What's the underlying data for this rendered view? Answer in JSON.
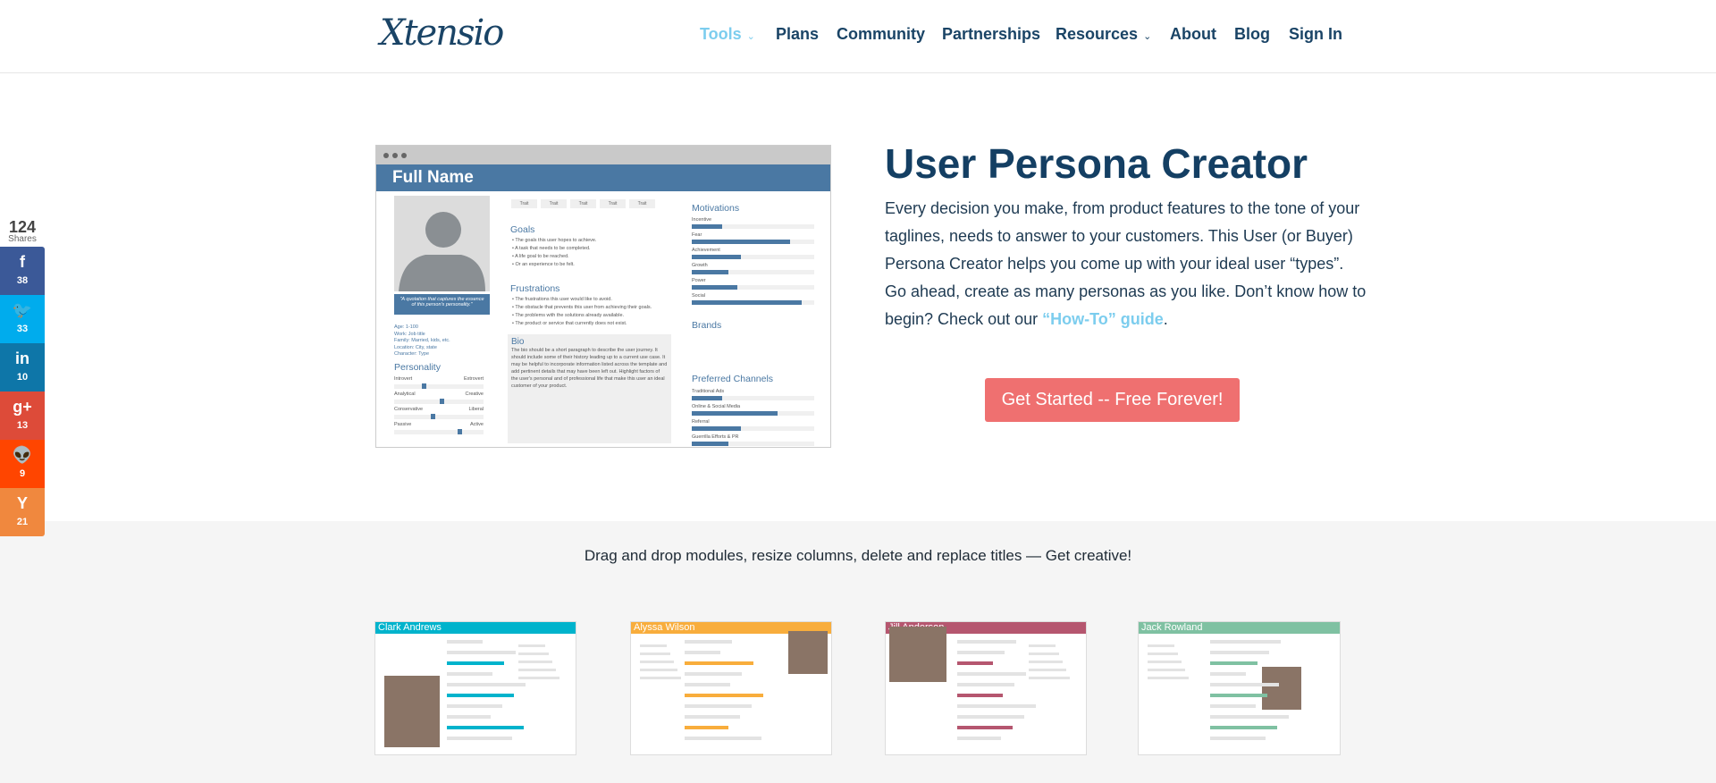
{
  "header": {
    "logo": "Xtensio",
    "nav": [
      {
        "label": "Tools",
        "dropdown": true,
        "active": true
      },
      {
        "label": "Plans"
      },
      {
        "label": "Community"
      },
      {
        "label": "Partnerships"
      },
      {
        "label": "Resources",
        "dropdown": true
      },
      {
        "label": "About"
      },
      {
        "label": "Blog"
      },
      {
        "label": "Sign In"
      }
    ]
  },
  "share": {
    "total": "124",
    "label": "Shares",
    "buttons": [
      {
        "icon": "facebook-icon",
        "glyph": "f",
        "count": "38",
        "color": "#3b5998"
      },
      {
        "icon": "twitter-icon",
        "glyph": "🐦",
        "count": "33",
        "color": "#00aced"
      },
      {
        "icon": "linkedin-icon",
        "glyph": "in",
        "count": "10",
        "color": "#0e76a8"
      },
      {
        "icon": "google-plus-icon",
        "glyph": "g+",
        "count": "13",
        "color": "#dd4b39"
      },
      {
        "icon": "reddit-icon",
        "glyph": "👽",
        "count": "9",
        "color": "#ff4500"
      },
      {
        "icon": "hacker-news-icon",
        "glyph": "Y",
        "count": "21",
        "color": "#f0883e"
      }
    ]
  },
  "hero": {
    "title": "User Persona Creator",
    "text": "Every decision you make, from product features to the tone of your taglines, needs to answer to your customers. This User (or Buyer) Persona Creator helps you come up with your ideal user “types”. Go ahead, create as many personas as you like. Don’t know how to begin? Check out our ",
    "link": "“How-To” guide",
    "text_end": ".",
    "cta": "Get Started -- Free Forever!",
    "cta_color": "#ef7070"
  },
  "mockup": {
    "name": "Full Name",
    "quote": "\"A quotation that captures the essence of this person's personality.\"",
    "info": [
      "Age: 1-100",
      "Work: Job title",
      "Family: Married, kids, etc.",
      "Location: City, state",
      "Character: Type"
    ],
    "personality_title": "Personality",
    "personality": [
      {
        "left": "Introvert",
        "right": "Extrovert",
        "value": 0.33
      },
      {
        "left": "Analytical",
        "right": "Creative",
        "value": 0.53
      },
      {
        "left": "Conservative",
        "right": "Liberal",
        "value": 0.43
      },
      {
        "left": "Passive",
        "right": "Active",
        "value": 0.73
      }
    ],
    "traits": [
      "Trait",
      "Trait",
      "Trait",
      "Trait",
      "Trait"
    ],
    "goals_title": "Goals",
    "goals": [
      "The goals this user hopes to achieve.",
      "A task that needs to be completed.",
      "A life goal to be reached.",
      "Or an experience to be felt."
    ],
    "frustrations_title": "Frustrations",
    "frustrations": [
      "The frustrations this user would like to avoid.",
      "The obstacle that prevents this user from achieving their goals.",
      "The problems with the solutions already available.",
      "The product or service that currently does not exist."
    ],
    "bio_title": "Bio",
    "bio": "The bio should be a short paragraph to describe the user journey. It should include some of their history leading up to a current use case. It may be helpful to incorporate information listed across the template and add pertinent details that may have been left out. Highlight factors of the user's personal and of professional life that make this user an ideal customer of your product.",
    "motivations_title": "Motivations",
    "motivations": [
      {
        "label": "Incentive",
        "value": 0.25
      },
      {
        "label": "Fear",
        "value": 0.8
      },
      {
        "label": "Achievement",
        "value": 0.4
      },
      {
        "label": "Growth",
        "value": 0.3
      },
      {
        "label": "Power",
        "value": 0.37
      },
      {
        "label": "Social",
        "value": 0.9
      }
    ],
    "brands_title": "Brands",
    "channels_title": "Preferred Channels",
    "channels": [
      {
        "label": "Traditional Ads",
        "value": 0.25
      },
      {
        "label": "Online & Social Media",
        "value": 0.7
      },
      {
        "label": "Referral",
        "value": 0.4
      },
      {
        "label": "Guerrilla Efforts & PR",
        "value": 0.3
      }
    ]
  },
  "section": {
    "text": "Drag and drop modules, resize columns, delete and replace titles — Get creative!"
  },
  "examples": [
    {
      "name": "Clark Andrews",
      "color": "#00b3cc"
    },
    {
      "name": "Alyssa Wilson",
      "color": "#f8ad3c"
    },
    {
      "name": "Jill Anderson",
      "color": "#b5566f"
    },
    {
      "name": "Jack Rowland",
      "color": "#7fc1a2"
    }
  ]
}
